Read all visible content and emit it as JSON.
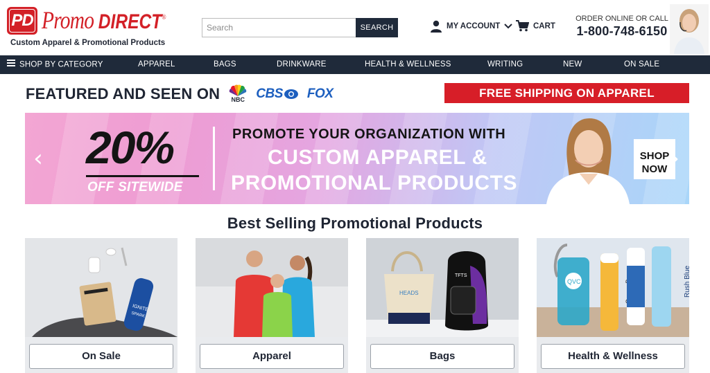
{
  "brand": {
    "badge": "PD",
    "name_first": "Promo",
    "name_second": "DIRECT",
    "registered": "®",
    "tagline": "Custom Apparel & Promotional Products"
  },
  "search": {
    "placeholder": "Search",
    "button_label": "SEARCH"
  },
  "account": {
    "label": "MY ACCOUNT"
  },
  "cart": {
    "label": "CART"
  },
  "contact": {
    "label": "ORDER ONLINE OR CALL",
    "phone": "1-800-748-6150"
  },
  "nav": {
    "items": [
      {
        "label": "SHOP BY CATEGORY"
      },
      {
        "label": "APPAREL"
      },
      {
        "label": "BAGS"
      },
      {
        "label": "DRINKWARE"
      },
      {
        "label": "HEALTH & WELLNESS"
      },
      {
        "label": "WRITING"
      },
      {
        "label": "NEW"
      },
      {
        "label": "ON SALE"
      }
    ]
  },
  "featured": {
    "title": "FEATURED AND SEEN ON",
    "networks": [
      {
        "label": "NBC"
      },
      {
        "label": "CBS"
      },
      {
        "label": "FOX"
      }
    ]
  },
  "shipping_banner": "FREE SHIPPING ON APPAREL",
  "hero": {
    "percent": "20%",
    "off_text": "OFF SITEWIDE",
    "line1": "PROMOTE YOUR ORGANIZATION WITH",
    "line2": "CUSTOM APPAREL &",
    "line3": "PROMOTIONAL PRODUCTS",
    "shop_line1": "SHOP",
    "shop_line2": "NOW",
    "prev": "‹",
    "next": "›"
  },
  "best_selling": {
    "title": "Best Selling Promotional Products",
    "cards": [
      {
        "label": "On Sale",
        "imprints": [
          "IGNITE",
          "SPARK"
        ]
      },
      {
        "label": "Apparel",
        "imprints": []
      },
      {
        "label": "Bags",
        "imprints": [
          "HEADS",
          "TFTS"
        ]
      },
      {
        "label": "Health & Wellness",
        "imprints": [
          "QVC",
          "Queen Bee",
          "Rush Blue"
        ]
      }
    ]
  },
  "colors": {
    "brand_red": "#d32027",
    "navy": "#1f2a3a",
    "banner_red": "#d71e28"
  }
}
